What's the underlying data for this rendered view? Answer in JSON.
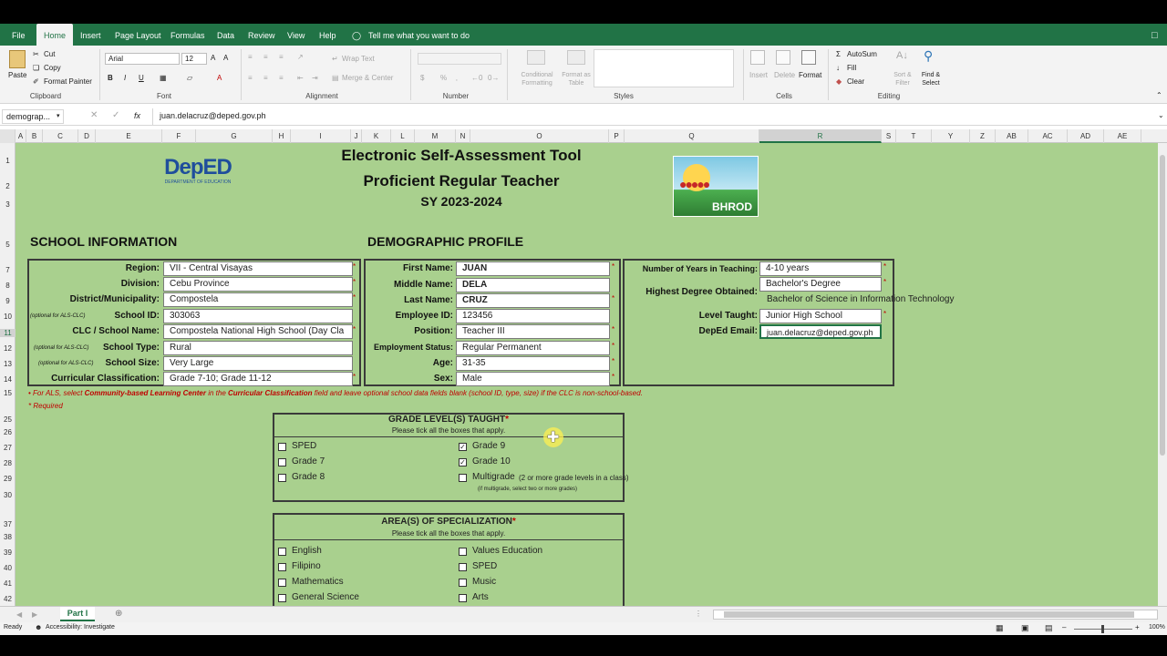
{
  "ribbon": {
    "tabs": [
      "File",
      "Home",
      "Insert",
      "Page Layout",
      "Formulas",
      "Data",
      "Review",
      "View",
      "Help"
    ],
    "tell_me": "Tell me what you want to do",
    "clipboard": {
      "paste": "Paste",
      "cut": "Cut",
      "copy": "Copy",
      "format_painter": "Format Painter",
      "label": "Clipboard"
    },
    "font": {
      "name": "Arial",
      "size": "12",
      "label": "Font"
    },
    "alignment": {
      "wrap": "Wrap Text",
      "merge": "Merge & Center",
      "label": "Alignment"
    },
    "number": {
      "label": "Number"
    },
    "styles": {
      "conditional": "Conditional Formatting",
      "format_table": "Format as Table",
      "label": "Styles"
    },
    "cells": {
      "insert": "Insert",
      "delete": "Delete",
      "format": "Format",
      "label": "Cells"
    },
    "editing": {
      "autosum": "AutoSum",
      "fill": "Fill",
      "clear": "Clear",
      "sort": "Sort & Filter",
      "find": "Find & Select",
      "label": "Editing"
    }
  },
  "formula_bar": {
    "name_box": "demograp...",
    "value": "juan.delacruz@deped.gov.ph",
    "fx": "fx"
  },
  "columns": [
    "A",
    "B",
    "C",
    "D",
    "E",
    "F",
    "G",
    "H",
    "I",
    "J",
    "K",
    "L",
    "M",
    "N",
    "O",
    "P",
    "Q",
    "R",
    "S",
    "T",
    "Y",
    "Z",
    "AB",
    "AC",
    "AD",
    "AE"
  ],
  "rows": [
    "1",
    "2",
    "3",
    "5",
    "7",
    "8",
    "9",
    "10",
    "11",
    "12",
    "13",
    "14",
    "15",
    "25",
    "26",
    "27",
    "28",
    "29",
    "30",
    "37",
    "38",
    "39",
    "40",
    "41",
    "42"
  ],
  "header": {
    "title": "Electronic Self-Assessment Tool",
    "subtitle": "Proficient Regular Teacher",
    "year": "SY 2023-2024",
    "deped_logo": "DepED",
    "deped_sub": "DEPARTMENT OF EDUCATION",
    "bhrod": "BHROD"
  },
  "school": {
    "heading": "SCHOOL INFORMATION",
    "fields": [
      {
        "label": "Region:",
        "note": "",
        "value": "VII - Central Visayas"
      },
      {
        "label": "Division:",
        "note": "",
        "value": "Cebu Province"
      },
      {
        "label": "District/Municipality:",
        "note": "",
        "value": "Compostela"
      },
      {
        "label": "School ID:",
        "note": "(optional for ALS-CLC)",
        "value": "303063"
      },
      {
        "label": "CLC / School Name:",
        "note": "",
        "value": "Compostela National High School (Day Cla"
      },
      {
        "label": "School Type:",
        "note": "(optional for ALS-CLC)",
        "value": "Rural"
      },
      {
        "label": "School Size:",
        "note": "(optional for ALS-CLC)",
        "value": "Very Large"
      },
      {
        "label": "Curricular Classification:",
        "note": "",
        "value": "Grade 7-10; Grade 11-12"
      }
    ]
  },
  "demographic": {
    "heading": "DEMOGRAPHIC PROFILE",
    "fields": [
      {
        "label": "First Name:",
        "value": "JUAN"
      },
      {
        "label": "Middle Name:",
        "value": "DELA"
      },
      {
        "label": "Last Name:",
        "value": "CRUZ"
      },
      {
        "label": "Employee ID:",
        "value": "123456"
      },
      {
        "label": "Position:",
        "value": "Teacher III"
      },
      {
        "label": "Employment Status:",
        "value": "Regular Permanent"
      },
      {
        "label": "Age:",
        "value": "31-35"
      },
      {
        "label": "Sex:",
        "value": "Male"
      }
    ],
    "right": [
      {
        "label": "Number of Years in Teaching:",
        "value": "4-10 years"
      },
      {
        "label": "Highest Degree Obtained:",
        "value": "Bachelor's Degree",
        "value2": "Bachelor of Science in Information Technology"
      },
      {
        "label": "Level Taught:",
        "value": "Junior High School"
      },
      {
        "label": "DepEd Email:",
        "value": "juan.delacruz@deped.gov.ph"
      }
    ]
  },
  "notes": {
    "als_pre": "• For ALS, select ",
    "als_b1": "Community-based Learning Center",
    "als_mid": " in the ",
    "als_b2": "Curricular Classification",
    "als_post": " field and leave optional school data fields blank (school ID, type, size) if the CLC is non-school-based.",
    "required": "* Required"
  },
  "grade": {
    "title": "GRADE LEVEL(S) TAUGHT",
    "sub": "Please tick all the boxes that apply.",
    "items": [
      {
        "label": "SPED",
        "checked": ""
      },
      {
        "label": "Grade 7",
        "checked": ""
      },
      {
        "label": "Grade 8",
        "checked": ""
      },
      {
        "label": "Grade 9",
        "checked": "✓"
      },
      {
        "label": "Grade 10",
        "checked": "✓"
      },
      {
        "label": "Multigrade",
        "checked": ""
      }
    ],
    "multi_note": "(2 or more grade levels in a class)",
    "multi_sub": "(if multigrade, select two or more grades)"
  },
  "spec": {
    "title": "AREA(S) OF SPECIALIZATION",
    "sub": "Please tick all the boxes that apply.",
    "items": [
      "English",
      "Filipino",
      "Mathematics",
      "General Science",
      "Values Education",
      "SPED",
      "Music",
      "Arts"
    ]
  },
  "sheet_tab": "Part I",
  "status": {
    "ready": "Ready",
    "accessibility": "Accessibility: Investigate",
    "zoom": "100%"
  },
  "colors": {
    "excel_green": "#217346",
    "sheet_bg": "#a9d08e",
    "required_red": "#c00000"
  }
}
